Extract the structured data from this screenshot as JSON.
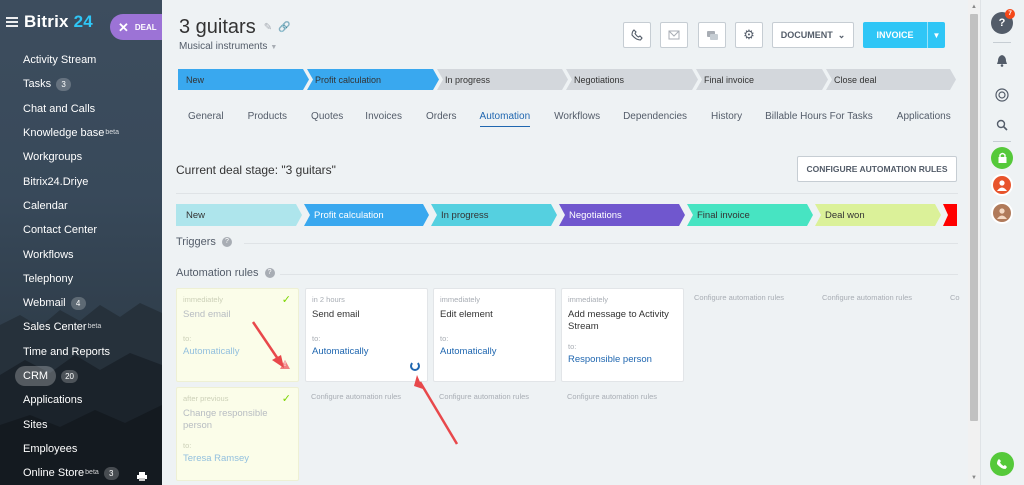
{
  "brand": {
    "name": "Bitrix",
    "num": "24"
  },
  "deal_pill": {
    "label": "DEAL",
    "close_icon": "close-icon"
  },
  "sidebar": {
    "items": [
      {
        "label": "Activity Stream"
      },
      {
        "label": "Tasks",
        "counter": "3"
      },
      {
        "label": "Chat and Calls"
      },
      {
        "label": "Knowledge base",
        "sup": "beta"
      },
      {
        "label": "Workgroups"
      },
      {
        "label": "Bitrix24.Driye"
      },
      {
        "label": "Calendar"
      },
      {
        "label": "Contact Center"
      },
      {
        "label": "Workflows"
      },
      {
        "label": "Telephony"
      },
      {
        "label": "Webmail",
        "counter": "4"
      },
      {
        "label": "Sales Center",
        "sup": "beta"
      },
      {
        "label": "Time and Reports"
      },
      {
        "label": "CRM",
        "counter": "20"
      },
      {
        "label": "Applications"
      },
      {
        "label": "Sites"
      },
      {
        "label": "Employees"
      },
      {
        "label": "Online Store",
        "sup": "beta",
        "counter": "3"
      }
    ]
  },
  "header": {
    "title": "3 guitars",
    "subtitle": "Musical instruments",
    "document_label": "DOCUMENT",
    "invoice_label": "INVOICE",
    "icons": [
      "phone-icon",
      "mail-icon",
      "chat-icon",
      "gear-icon"
    ]
  },
  "top_stages": [
    {
      "label": "New",
      "color": "#39a8ef"
    },
    {
      "label": "Profit calculation",
      "color": "#39a8ef"
    },
    {
      "label": "In progress",
      "color": "#d3d7dc"
    },
    {
      "label": "Negotiations",
      "color": "#d3d7dc"
    },
    {
      "label": "Final invoice",
      "color": "#d3d7dc"
    },
    {
      "label": "Close deal",
      "color": "#d3d7dc"
    }
  ],
  "tabs": [
    {
      "label": "General"
    },
    {
      "label": "Products"
    },
    {
      "label": "Quotes"
    },
    {
      "label": "Invoices"
    },
    {
      "label": "Orders"
    },
    {
      "label": "Automation",
      "active": true
    },
    {
      "label": "Workflows"
    },
    {
      "label": "Dependencies"
    },
    {
      "label": "History"
    },
    {
      "label": "Billable Hours For Tasks"
    },
    {
      "label": "Applications"
    }
  ],
  "automation": {
    "current_stage": "Current deal stage: \"3 guitars\"",
    "configure_button": "CONFIGURE AUTOMATION RULES",
    "triggers_title": "Triggers",
    "rules_title": "Automation rules",
    "stages": [
      {
        "label": "New",
        "color": "#aee5ec",
        "text": "#333"
      },
      {
        "label": "Profit calculation",
        "color": "#39a8ef",
        "text": "#ffffff"
      },
      {
        "label": "In progress",
        "color": "#55d0e0",
        "text": "#333"
      },
      {
        "label": "Negotiations",
        "color": "#7057ce",
        "text": "#ffffff"
      },
      {
        "label": "Final invoice",
        "color": "#47e4c2",
        "text": "#333"
      },
      {
        "label": "Deal won",
        "color": "#dbf199",
        "text": "#333"
      },
      {
        "label": "",
        "color": "#ff0000",
        "text": "#ffffff"
      }
    ],
    "cards": [
      {
        "when": "immediately",
        "name": "Send email",
        "to": "to:",
        "target": "Automatically",
        "disabled": true,
        "check": true,
        "warn": true
      },
      {
        "when": "in 2 hours",
        "name": "Send email",
        "to": "to:",
        "target": "Automatically",
        "disabled": false,
        "loading": true
      },
      {
        "when": "immediately",
        "name": "Edit element",
        "to": "to:",
        "target": "Automatically",
        "disabled": false
      },
      {
        "when": "immediately",
        "name": "Add message to Activity Stream",
        "to": "to:",
        "target": "Responsible person",
        "disabled": false
      },
      {
        "when": "after previous",
        "name": "Change responsible person",
        "to": "to:",
        "target": "Teresa Ramsey",
        "disabled": true,
        "check": true
      }
    ],
    "config_links": [
      "Configure automation rules",
      "Configure automation rules",
      "Co",
      "Configure automation rules",
      "Configure automation rules",
      "Configure automation rules"
    ]
  },
  "right_panel": {
    "help_badge": "7"
  }
}
